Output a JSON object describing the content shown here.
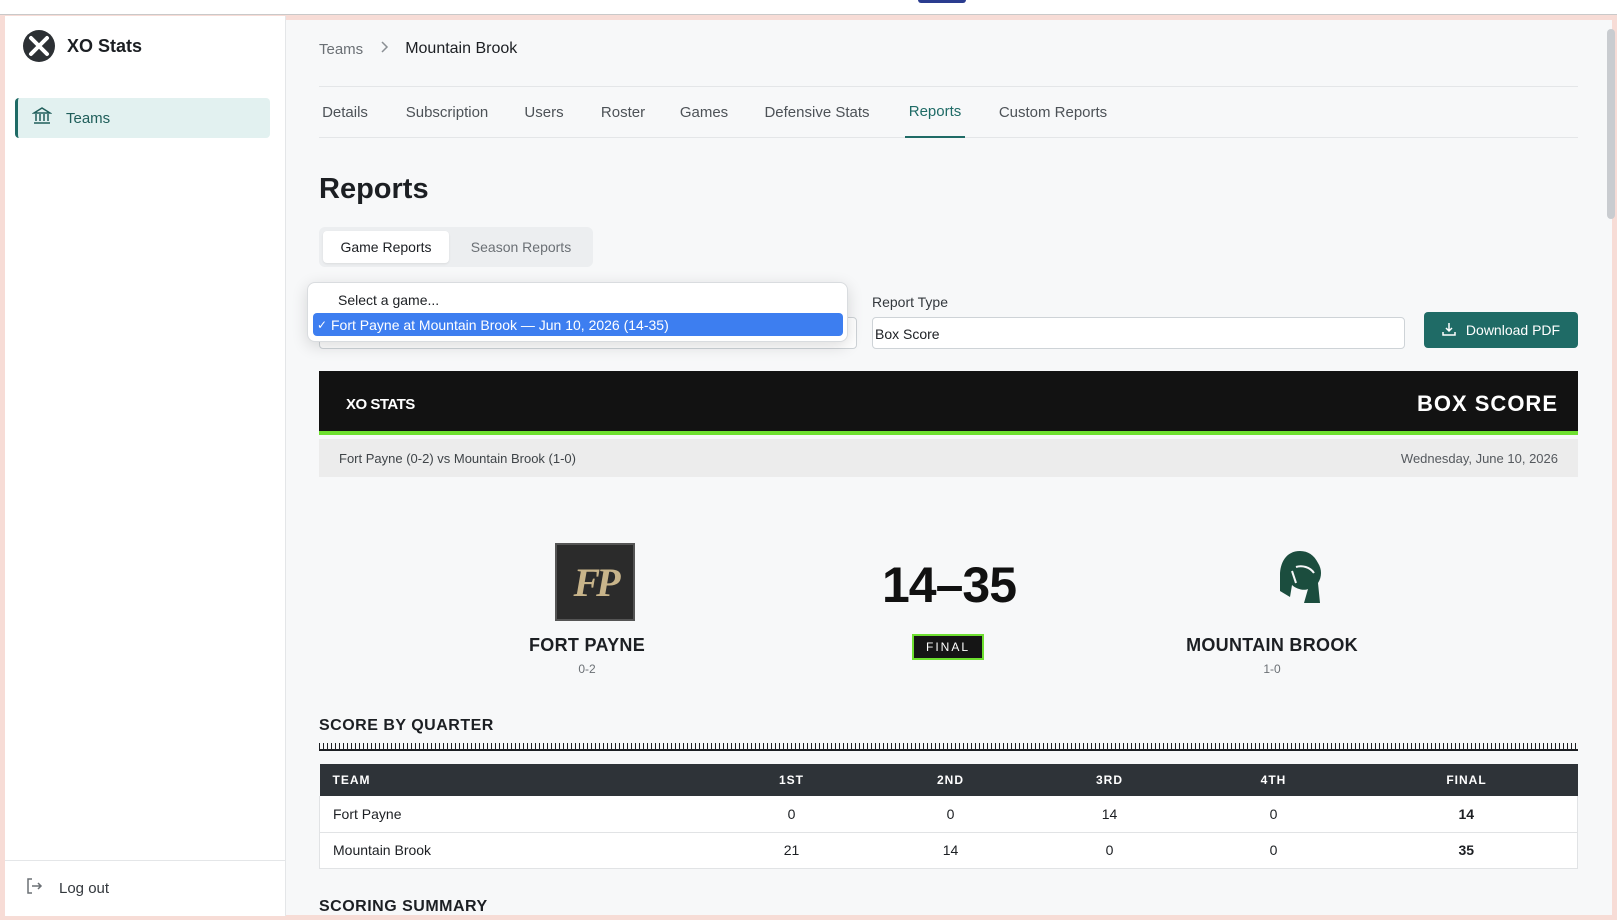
{
  "app": {
    "name": "XO Stats"
  },
  "sidebar": {
    "items": [
      {
        "label": "Teams",
        "icon": "building-columns-icon"
      }
    ],
    "logout_label": "Log out"
  },
  "breadcrumb": {
    "parent": "Teams",
    "current": "Mountain Brook"
  },
  "tabs": [
    {
      "label": "Details"
    },
    {
      "label": "Subscription"
    },
    {
      "label": "Users"
    },
    {
      "label": "Roster"
    },
    {
      "label": "Games"
    },
    {
      "label": "Defensive Stats"
    },
    {
      "label": "Reports",
      "active": true
    },
    {
      "label": "Custom Reports"
    }
  ],
  "page": {
    "title": "Reports",
    "segments": [
      {
        "label": "Game Reports",
        "active": true
      },
      {
        "label": "Season Reports"
      }
    ]
  },
  "filters": {
    "game_select": {
      "options": [
        "Select a game...",
        "Fort Payne at Mountain Brook — Jun 10, 2026 (14-35)"
      ],
      "selected": "Fort Payne at Mountain Brook — Jun 10, 2026 (14-35)",
      "check": "✓"
    },
    "report_type": {
      "label": "Report Type",
      "value": "Box Score"
    },
    "download_label": "Download PDF"
  },
  "report": {
    "brand": "XO STATS",
    "title": "BOX SCORE",
    "matchup": "Fort Payne (0-2) vs Mountain Brook (1-0)",
    "date": "Wednesday, June 10, 2026",
    "away": {
      "name": "FORT PAYNE",
      "record": "0-2",
      "logo_text": "FP"
    },
    "home": {
      "name": "MOUNTAIN BROOK",
      "record": "1-0"
    },
    "score": "14–35",
    "status": "FINAL",
    "accent_color": "#6ee030",
    "score_by_quarter": {
      "title": "SCORE BY QUARTER",
      "headers": [
        "TEAM",
        "1ST",
        "2ND",
        "3RD",
        "4TH",
        "FINAL"
      ],
      "rows": [
        [
          "Fort Payne",
          "0",
          "0",
          "14",
          "0",
          "14"
        ],
        [
          "Mountain Brook",
          "21",
          "14",
          "0",
          "0",
          "35"
        ]
      ]
    },
    "scoring_summary_title": "SCORING SUMMARY"
  },
  "colors": {
    "primary": "#1f6b66",
    "selection": "#3d7ef0",
    "header_bg": "#121212"
  }
}
